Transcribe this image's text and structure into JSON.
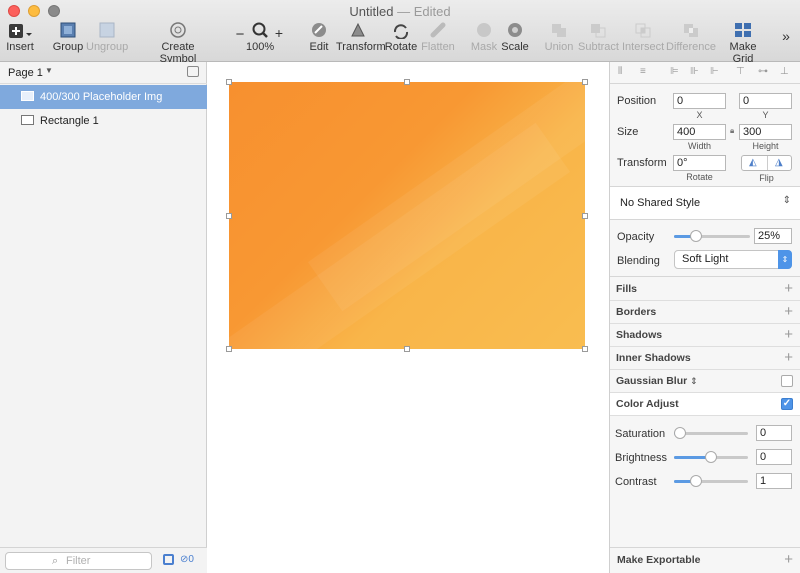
{
  "window": {
    "title": "Untitled",
    "edited": "— Edited"
  },
  "toolbar": {
    "insert": "Insert",
    "group": "Group",
    "ungroup": "Ungroup",
    "create_symbol": "Create Symbol",
    "zoom_minus": "−",
    "zoom_plus": "+",
    "zoom": "100%",
    "edit": "Edit",
    "transform": "Transform",
    "rotate": "Rotate",
    "flatten": "Flatten",
    "mask": "Mask",
    "scale": "Scale",
    "union": "Union",
    "subtract": "Subtract",
    "intersect": "Intersect",
    "difference": "Difference",
    "make_grid": "Make Grid",
    "more": "»"
  },
  "layers": {
    "page": "Page 1",
    "items": [
      {
        "label": "400/300 Placeholder Img",
        "selected": true
      },
      {
        "label": "Rectangle 1",
        "selected": false
      }
    ],
    "filter_placeholder": "Filter",
    "count": "0"
  },
  "inspector": {
    "position": {
      "label": "Position",
      "x": "0",
      "y": "0",
      "x_label": "X",
      "y_label": "Y"
    },
    "size": {
      "label": "Size",
      "width": "400",
      "height": "300",
      "w_label": "Width",
      "h_label": "Height"
    },
    "transform": {
      "label": "Transform",
      "rotate": "0°",
      "rotate_label": "Rotate",
      "flip_label": "Flip"
    },
    "shared_style": "No Shared Style",
    "opacity": {
      "label": "Opacity",
      "value": "25%",
      "level": 0.25
    },
    "blending": {
      "label": "Blending",
      "value": "Soft Light"
    },
    "sections": {
      "fills": "Fills",
      "borders": "Borders",
      "shadows": "Shadows",
      "inner_shadows": "Inner Shadows",
      "gaussian_blur": "Gaussian Blur",
      "color_adjust": "Color Adjust"
    },
    "color_adjust": {
      "saturation": {
        "label": "Saturation",
        "value": "0",
        "level": 0
      },
      "brightness": {
        "label": "Brightness",
        "value": "0",
        "level": 0.5
      },
      "contrast": {
        "label": "Contrast",
        "value": "1",
        "level": 0.25
      }
    },
    "make_exportable": "Make Exportable"
  },
  "colors": {
    "accent": "#4e94e8",
    "selection": "#7fa9dd",
    "artwork_start": "#f7902f",
    "artwork_end": "#f9bd50"
  }
}
